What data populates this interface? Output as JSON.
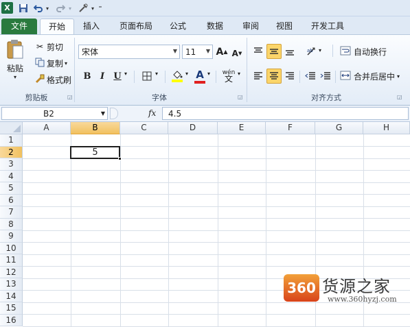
{
  "app": {
    "logo": "X"
  },
  "quick_access": {
    "save_icon": "save-icon",
    "undo_icon": "undo-icon",
    "redo_icon": "redo-icon",
    "tool_icon": "tool-icon",
    "customize_icon": "customize-icon"
  },
  "tabs": [
    {
      "label": "文件"
    },
    {
      "label": "开始"
    },
    {
      "label": "插入"
    },
    {
      "label": "页面布局"
    },
    {
      "label": "公式"
    },
    {
      "label": "数据"
    },
    {
      "label": "审阅"
    },
    {
      "label": "视图"
    },
    {
      "label": "开发工具"
    }
  ],
  "clipboard": {
    "paste_label": "粘贴",
    "cut_label": "剪切",
    "copy_label": "复制",
    "format_painter_label": "格式刷",
    "group_label": "剪贴板"
  },
  "font": {
    "font_name": "宋体",
    "font_size": "11",
    "bold": "B",
    "italic": "I",
    "underline": "U",
    "font_color_glyph": "A",
    "wen_glyph": "wén",
    "group_label": "字体"
  },
  "alignment": {
    "wrap_text_label": "自动换行",
    "merge_center_label": "合并后居中",
    "group_label": "对齐方式"
  },
  "formula_bar": {
    "name_box": "B2",
    "fx": "fx",
    "value": "4.5"
  },
  "grid": {
    "columns": [
      "A",
      "B",
      "C",
      "D",
      "E",
      "F",
      "G",
      "H"
    ],
    "rows": [
      "1",
      "2",
      "3",
      "4",
      "5",
      "6",
      "7",
      "8",
      "9",
      "10",
      "11",
      "12",
      "13",
      "14",
      "15",
      "16"
    ],
    "active_cell_display": "5",
    "active_column": "B",
    "active_row": "2"
  },
  "watermark": {
    "logo_text": "360",
    "brand": "货源之家",
    "url": "www.360hyzj.com"
  },
  "colors": {
    "file_tab": "#2a7a3e",
    "selection": "#fbd56a",
    "header_active": "#f1c15f"
  }
}
